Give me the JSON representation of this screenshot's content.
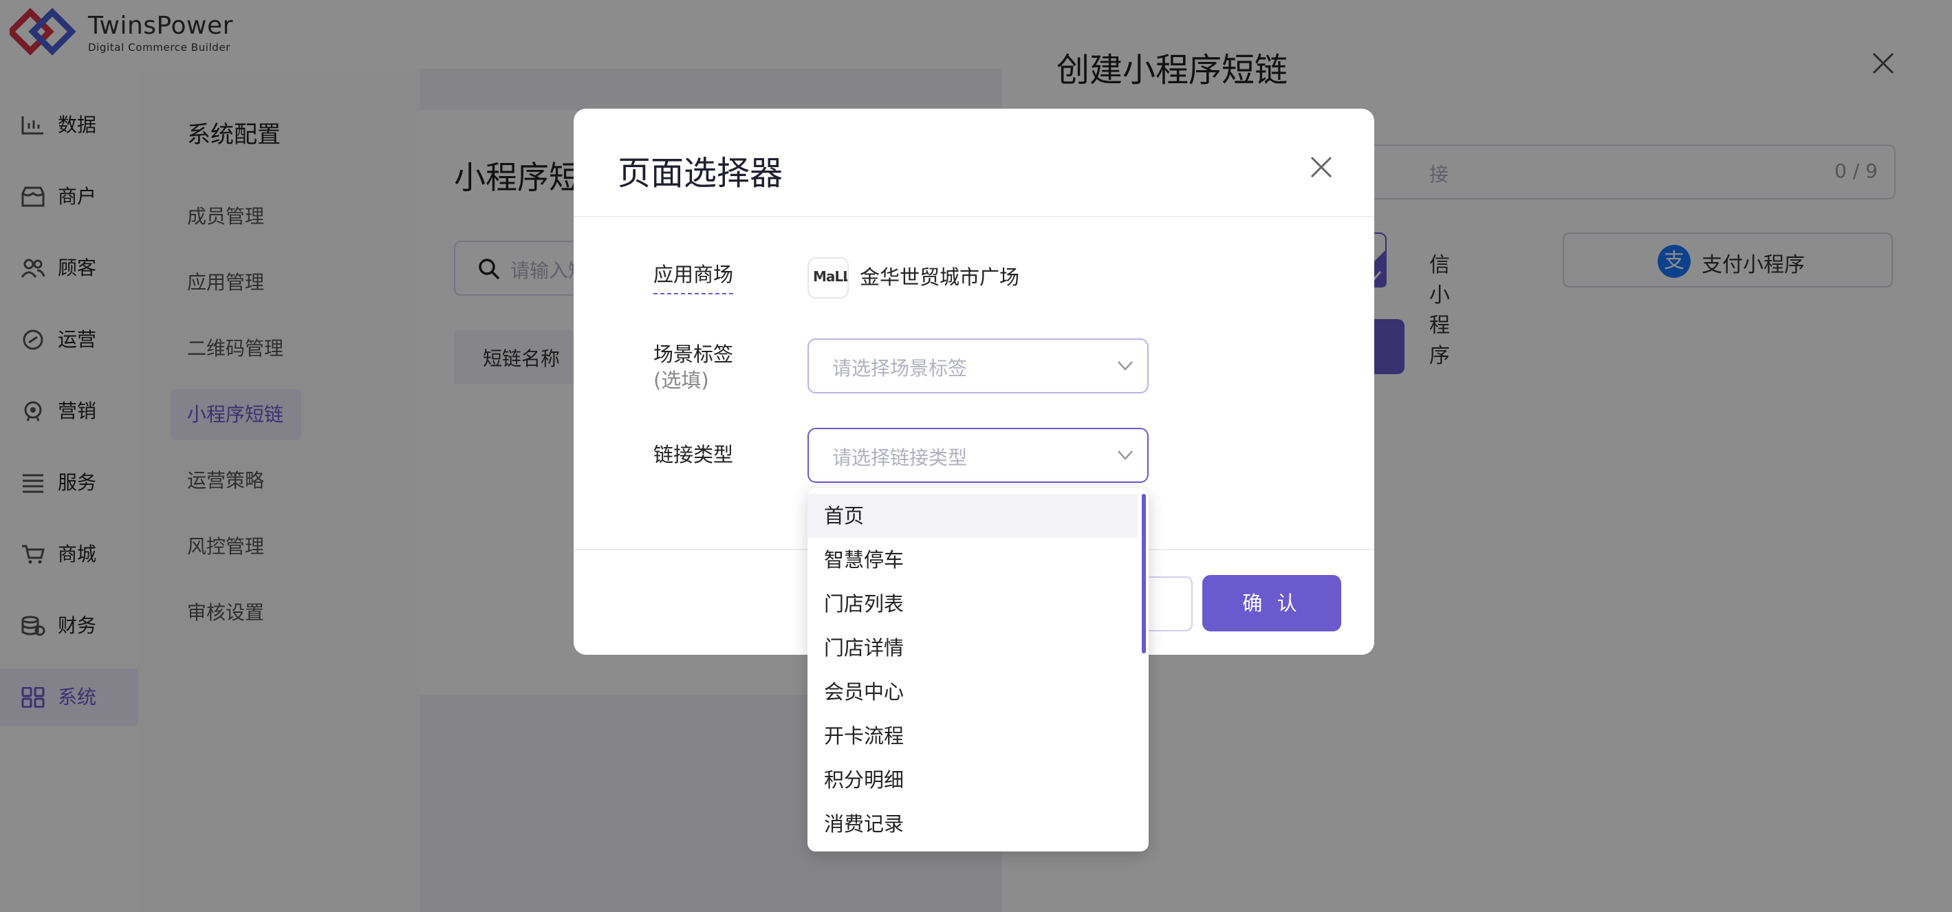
{
  "brand": {
    "name": "TwinsPower",
    "tagline": "Digital Commerce Builder"
  },
  "nav": {
    "items": [
      {
        "label": "数据",
        "icon": "chart-icon"
      },
      {
        "label": "商户",
        "icon": "store-icon"
      },
      {
        "label": "顾客",
        "icon": "users-icon"
      },
      {
        "label": "运营",
        "icon": "link-icon"
      },
      {
        "label": "营销",
        "icon": "marketing-icon"
      },
      {
        "label": "服务",
        "icon": "list-icon"
      },
      {
        "label": "商城",
        "icon": "cart-icon"
      },
      {
        "label": "财务",
        "icon": "coins-icon"
      },
      {
        "label": "系统",
        "icon": "grid-icon",
        "active": true
      }
    ]
  },
  "subnav": {
    "title": "系统配置",
    "items": [
      {
        "label": "成员管理"
      },
      {
        "label": "应用管理"
      },
      {
        "label": "二维码管理"
      },
      {
        "label": "小程序短链",
        "active": true
      },
      {
        "label": "运营策略"
      },
      {
        "label": "风控管理"
      },
      {
        "label": "审核设置"
      }
    ]
  },
  "main": {
    "title": "小程序短",
    "search_placeholder": "请输入短",
    "table_header": "短链名称"
  },
  "drawer": {
    "title": "创建小程序短链",
    "input_placeholder_fragment": "接",
    "input_counter": "0 / 9",
    "wechat_label_fragment": "信小程序",
    "alipay_label": "支付小程序",
    "alipay_glyph": "支"
  },
  "modal": {
    "title": "页面选择器",
    "app_label": "应用商场",
    "app_logo_text": "MaLL",
    "app_name": "金华世贸城市广场",
    "scene_label": "场景标签",
    "scene_optional": "(选填)",
    "scene_placeholder": "请选择场景标签",
    "link_type_label": "链接类型",
    "link_type_placeholder": "请选择链接类型",
    "confirm_label": "确 认"
  },
  "dropdown": {
    "options": [
      {
        "label": "首页",
        "hover": true
      },
      {
        "label": "智慧停车"
      },
      {
        "label": "门店列表"
      },
      {
        "label": "门店详情"
      },
      {
        "label": "会员中心"
      },
      {
        "label": "开卡流程"
      },
      {
        "label": "积分明细"
      },
      {
        "label": "消费记录"
      }
    ]
  },
  "colors": {
    "accent": "#6a5acd",
    "alipay": "#1677ff"
  }
}
